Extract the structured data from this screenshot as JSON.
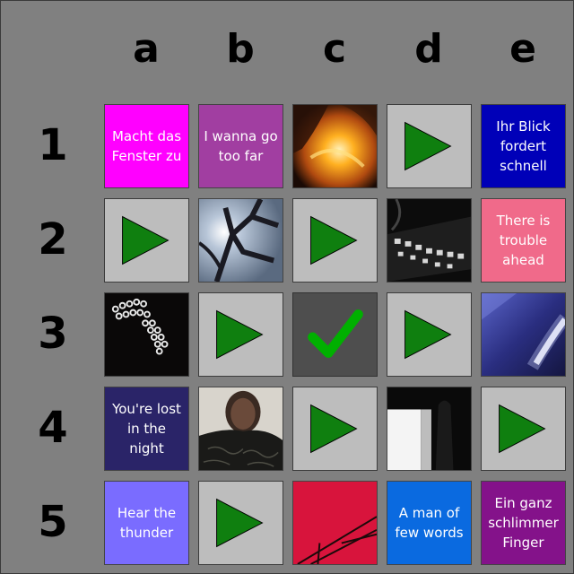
{
  "columns": [
    "a",
    "b",
    "c",
    "d",
    "e"
  ],
  "rows": [
    "1",
    "2",
    "3",
    "4",
    "5"
  ],
  "colors": {
    "background": "#808080",
    "tile_unplayed": "#bdbdbd",
    "tile_played": "#4e4e4e",
    "play_triangle": "#0f7f0f",
    "checkmark": "#00b000"
  },
  "cells": {
    "a1": {
      "type": "text",
      "text": "Macht das Fenster zu",
      "color": "#ff00ff"
    },
    "b1": {
      "type": "text",
      "text": "I wanna go too far",
      "color": "#a13ea1"
    },
    "c1": {
      "type": "image",
      "icon": "orange-abstract-cover"
    },
    "d1": {
      "type": "play",
      "icon": "play-icon"
    },
    "e1": {
      "type": "text",
      "text": "Ihr Blick fordert schnell",
      "color": "#0000b8"
    },
    "a2": {
      "type": "play",
      "icon": "play-icon"
    },
    "b2": {
      "type": "image",
      "icon": "branches-sky-cover"
    },
    "c2": {
      "type": "play",
      "icon": "play-icon"
    },
    "d2": {
      "type": "image",
      "icon": "studded-glove-cover"
    },
    "e2": {
      "type": "text",
      "text": "There is trouble ahead",
      "color": "#f06a8a"
    },
    "a3": {
      "type": "image",
      "icon": "beaded-hand-cover"
    },
    "b3": {
      "type": "play",
      "icon": "play-icon"
    },
    "c3": {
      "type": "played",
      "icon": "checkmark-icon"
    },
    "d3": {
      "type": "play",
      "icon": "play-icon"
    },
    "e3": {
      "type": "image",
      "icon": "blue-light-cover"
    },
    "a4": {
      "type": "text",
      "text": "You're lost in the night",
      "color": "#2a2468"
    },
    "b4": {
      "type": "image",
      "icon": "man-portrait-cover"
    },
    "c4": {
      "type": "play",
      "icon": "play-icon"
    },
    "d4": {
      "type": "image",
      "icon": "dark-figure-cover"
    },
    "e4": {
      "type": "play",
      "icon": "play-icon"
    },
    "a5": {
      "type": "text",
      "text": "Hear the thunder",
      "color": "#7a6cff"
    },
    "b5": {
      "type": "play",
      "icon": "play-icon"
    },
    "c5": {
      "type": "image",
      "icon": "red-lines-cover"
    },
    "d5": {
      "type": "text",
      "text": "A man of few words",
      "color": "#0a6ae0"
    },
    "e5": {
      "type": "text",
      "text": "Ein ganz schlimmer Finger",
      "color": "#84128a"
    }
  }
}
